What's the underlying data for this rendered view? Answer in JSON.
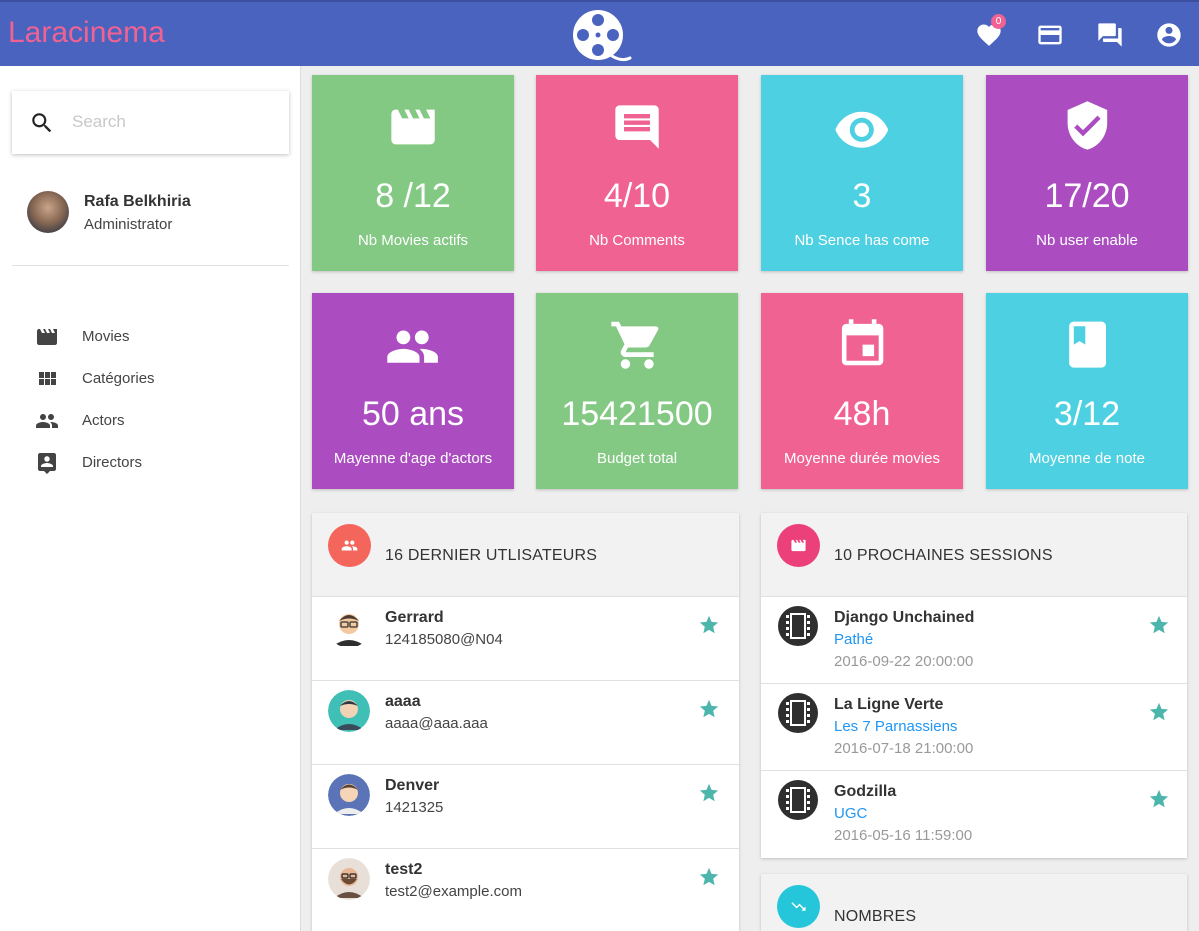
{
  "header": {
    "brand": "Laracinema",
    "favorites_count": "0",
    "colors": {
      "bar": "#4a63bf",
      "brand": "#f06292"
    },
    "icons": [
      "heart-icon",
      "credit-card-icon",
      "chat-icon",
      "account-icon"
    ]
  },
  "sidebar": {
    "search_placeholder": "Search",
    "user": {
      "name": "Rafa Belkhiria",
      "role": "Administrator"
    },
    "items": [
      {
        "label": "Movies",
        "icon": "movie-icon"
      },
      {
        "label": "Catégories",
        "icon": "grid-icon"
      },
      {
        "label": "Actors",
        "icon": "people-icon"
      },
      {
        "label": "Directors",
        "icon": "contact-icon"
      }
    ]
  },
  "stats": [
    {
      "value": "8 /12",
      "label": "Nb Movies actifs",
      "icon": "movie-icon",
      "color": "#83c984"
    },
    {
      "value": "4/10",
      "label": "Nb Comments",
      "icon": "comment-icon",
      "color": "#f06292"
    },
    {
      "value": "3",
      "label": "Nb Sence has come",
      "icon": "eye-icon",
      "color": "#4dd0e1"
    },
    {
      "value": "17/20",
      "label": "Nb user enable",
      "icon": "shield-check-icon",
      "color": "#ab4dc1"
    },
    {
      "value": "50 ans",
      "label": "Mayenne d'age d'actors",
      "icon": "people-icon",
      "color": "#ab4dc1"
    },
    {
      "value": "15421500",
      "label": "Budget total",
      "icon": "cart-icon",
      "color": "#83c984"
    },
    {
      "value": "48h",
      "label": "Moyenne durée movies",
      "icon": "calendar-icon",
      "color": "#f06292"
    },
    {
      "value": "3/12",
      "label": "Moyenne de note",
      "icon": "book-icon",
      "color": "#4dd0e1"
    }
  ],
  "users_panel": {
    "title": "16 DERNIER UTLISATEURS",
    "rows": [
      {
        "name": "Gerrard",
        "detail": "124185080@N04"
      },
      {
        "name": "aaaa",
        "detail": "aaaa@aaa.aaa"
      },
      {
        "name": "Denver",
        "detail": "1421325"
      },
      {
        "name": "test2",
        "detail": "test2@example.com"
      }
    ]
  },
  "sessions_panel": {
    "title": "10 PROCHAINES SESSIONS",
    "rows": [
      {
        "movie": "Django Unchained",
        "cinema": "Pathé",
        "date": "2016-09-22 20:00:00"
      },
      {
        "movie": "La Ligne Verte",
        "cinema": "Les 7 Parnassiens",
        "date": "2016-07-18 21:00:00"
      },
      {
        "movie": "Godzilla",
        "cinema": "UGC",
        "date": "2016-05-16 11:59:00"
      }
    ]
  },
  "numbers_panel": {
    "title": "NOMBRES"
  }
}
